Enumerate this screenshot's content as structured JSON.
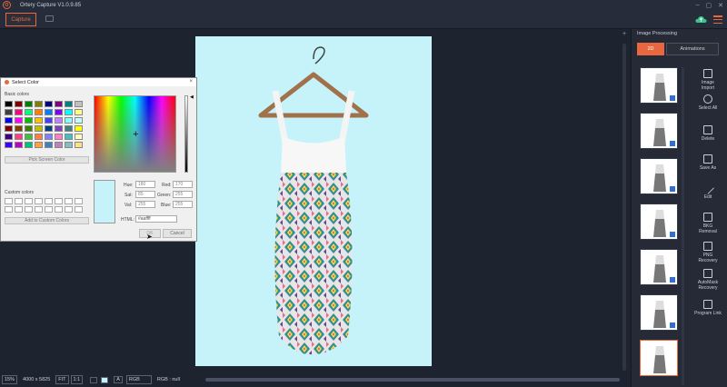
{
  "app": {
    "title": "Ortery Capture V1.0.9.85",
    "logo_letter": "O"
  },
  "toolbar": {
    "capture_label": "Capture"
  },
  "colors": {
    "accent": "#e8673e",
    "background": "#1e2330",
    "panel": "#252a36",
    "image_bg": "#c6f3f9",
    "selection": "#2f6fd6"
  },
  "status": {
    "zoom": "15%",
    "dimensions": "4000 x 5825",
    "fit_label": "FIT",
    "one_to_one_label": "1:1",
    "font_label": "A",
    "mode": "RGB",
    "rgb_readout": "RGB : null"
  },
  "panel": {
    "title": "Image Processing",
    "tabs": [
      {
        "label": "2D",
        "active": true
      },
      {
        "label": "Animations",
        "active": false
      }
    ],
    "thumbnail_count": 7,
    "selected_thumbnail": 7,
    "tools": [
      {
        "label": "Image\nImport",
        "icon": "image-import-icon"
      },
      {
        "label": "Select All",
        "icon": "select-all-icon"
      },
      {
        "label": "Delete",
        "icon": "trash-icon"
      },
      {
        "label": "Save As",
        "icon": "save-icon"
      },
      {
        "label": "Edit",
        "icon": "wand-icon"
      },
      {
        "label": "BKG\nRemoval",
        "icon": "bkg-removal-icon"
      },
      {
        "label": "PNG\nRecovery",
        "icon": "png-recovery-icon"
      },
      {
        "label": "AutoMask\nRecovery",
        "icon": "automask-icon"
      },
      {
        "label": "Program Link",
        "icon": "link-icon"
      }
    ]
  },
  "dialog": {
    "title": "Select Color",
    "close": "×",
    "basic_colors_label": "Basic colors",
    "basic_colors": [
      "#000000",
      "#800000",
      "#008000",
      "#808000",
      "#000080",
      "#800080",
      "#008080",
      "#c0c0c0",
      "#404040",
      "#ff0080",
      "#00ff80",
      "#ff8000",
      "#0080ff",
      "#8000ff",
      "#00ffff",
      "#ffff80",
      "#0000ff",
      "#ff00ff",
      "#00c000",
      "#ffc000",
      "#4040ff",
      "#c080ff",
      "#80ffff",
      "#c0ffff",
      "#800000",
      "#804000",
      "#408000",
      "#c0c000",
      "#004080",
      "#8040c0",
      "#408080",
      "#ffff00",
      "#400080",
      "#ff4080",
      "#40c040",
      "#ff8040",
      "#8080ff",
      "#ff80c0",
      "#40c0c0",
      "#ffffc0",
      "#4000ff",
      "#c000c0",
      "#00c080",
      "#ffa040",
      "#4080c0",
      "#c080c0",
      "#80c0c0",
      "#ffe080"
    ],
    "pick_screen_label": "Pick Screen Color",
    "custom_colors_label": "Custom colors",
    "add_custom_label": "Add to Custom Colors",
    "hue_label": "Hue:",
    "hue_value": "180",
    "sat_label": "Sat:",
    "sat_value": "85",
    "val_label": "Val:",
    "val_value": "255",
    "red_label": "Red:",
    "red_value": "170",
    "green_label": "Green:",
    "green_value": "255",
    "blue_label": "Blue:",
    "blue_value": "255",
    "html_label": "HTML:",
    "html_value": "#aaffff",
    "ok_label": "OK",
    "cancel_label": "Cancel"
  }
}
